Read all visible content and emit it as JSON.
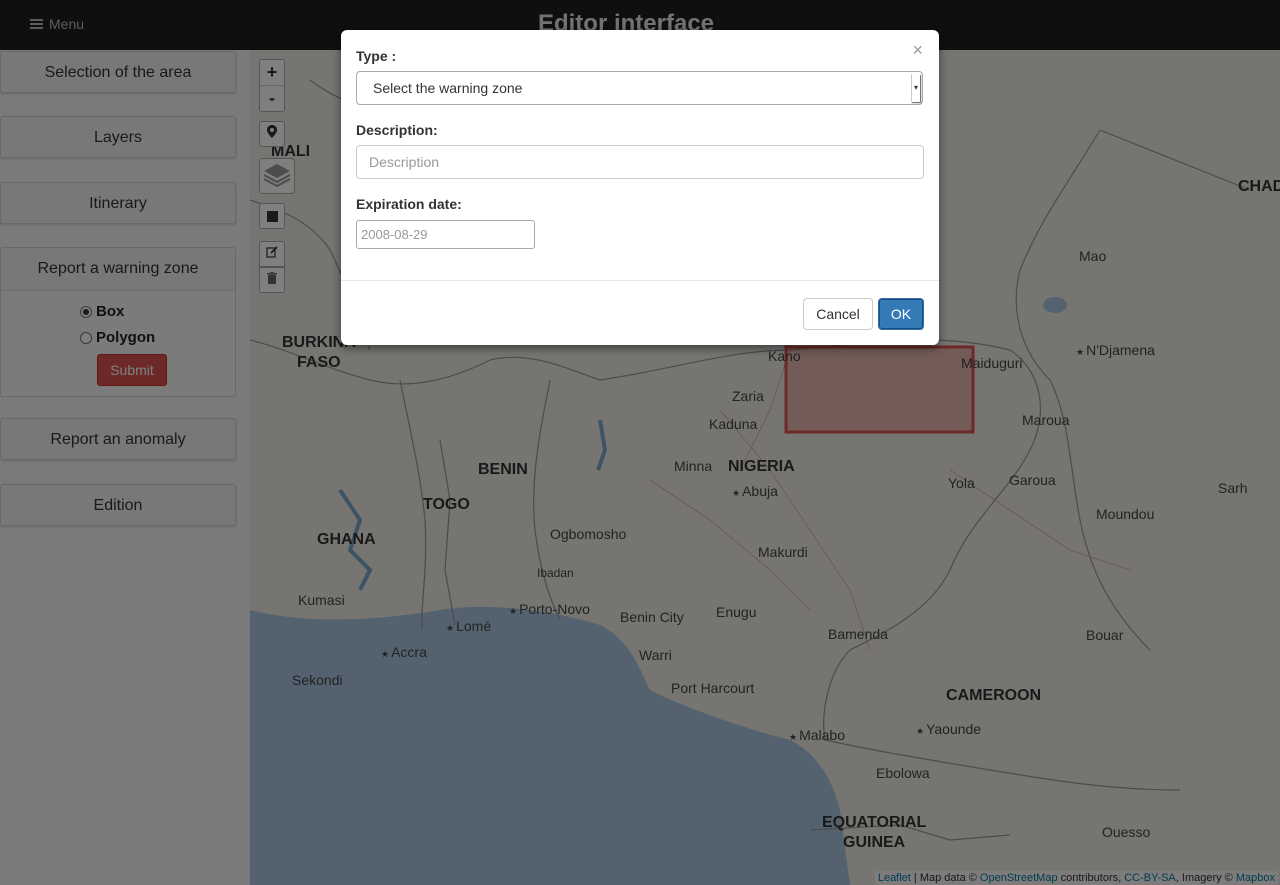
{
  "header": {
    "menu_label": "Menu",
    "app_title": "Editor interface"
  },
  "sidebar": {
    "selection_label": "Selection of the area",
    "layers_label": "Layers",
    "itinerary_label": "Itinerary",
    "warning_zone": {
      "title": "Report a warning zone",
      "options": [
        {
          "label": "Box",
          "selected": true
        },
        {
          "label": "Polygon",
          "selected": false
        }
      ],
      "submit_label": "Submit"
    },
    "anomaly_label": "Report an anomaly",
    "edition_label": "Edition"
  },
  "map": {
    "zoom_in": "+",
    "zoom_out": "-",
    "labels": {
      "mali": "MALI",
      "burkina1": "BURKINA",
      "burkina2": "FASO",
      "chad": "CHAD",
      "mao": "Mao",
      "ndjamena": "N'Djamena",
      "kano": "Kano",
      "maiduguri": "Maiduguri",
      "zaria": "Zaria",
      "kaduna": "Kaduna",
      "maroua": "Maroua",
      "benin": "BENIN",
      "minna": "Minna",
      "nigeria": "NIGERIA",
      "yola": "Yola",
      "garoua": "Garoua",
      "sarh": "Sarh",
      "abuja": "Abuja",
      "togo": "TOGO",
      "ghana": "GHANA",
      "ogbomosho": "Ogbomosho",
      "moundou": "Moundou",
      "makurdi": "Makurdi",
      "ibadan": "Ibadan",
      "kumasi": "Kumasi",
      "porto_novo": "Porto-Novo",
      "benin_city": "Benin City",
      "enugu": "Enugu",
      "lome": "Lomé",
      "bamenda": "Bamenda",
      "bouar": "Bouar",
      "accra": "Accra",
      "warri": "Warri",
      "sekondi": "Sekondi",
      "port_harcourt": "Port Harcourt",
      "cameroon": "CAMEROON",
      "yaounde": "Yaounde",
      "malabo": "Malabo",
      "ebolowa": "Ebolowa",
      "eq_guinea1": "EQUATORIAL",
      "eq_guinea2": "GUINEA",
      "ouesso": "Ouesso"
    },
    "attribution": {
      "leaflet": "Leaflet",
      "map_data": " | Map data © ",
      "osm": "OpenStreetMap",
      "contributors": " contributors, ",
      "license": "CC-BY-SA",
      "imagery": ", Imagery © ",
      "mapbox": "Mapbox"
    },
    "selection_color": "#d9534f",
    "water_color": "#a9c5df"
  },
  "modal": {
    "close_symbol": "×",
    "type_label": "Type :",
    "type_selected": "Select the warning zone",
    "description_label": "Description:",
    "description_placeholder": "Description",
    "expiration_label": "Expiration date:",
    "expiration_placeholder": "2008-08-29",
    "cancel_label": "Cancel",
    "ok_label": "OK"
  }
}
